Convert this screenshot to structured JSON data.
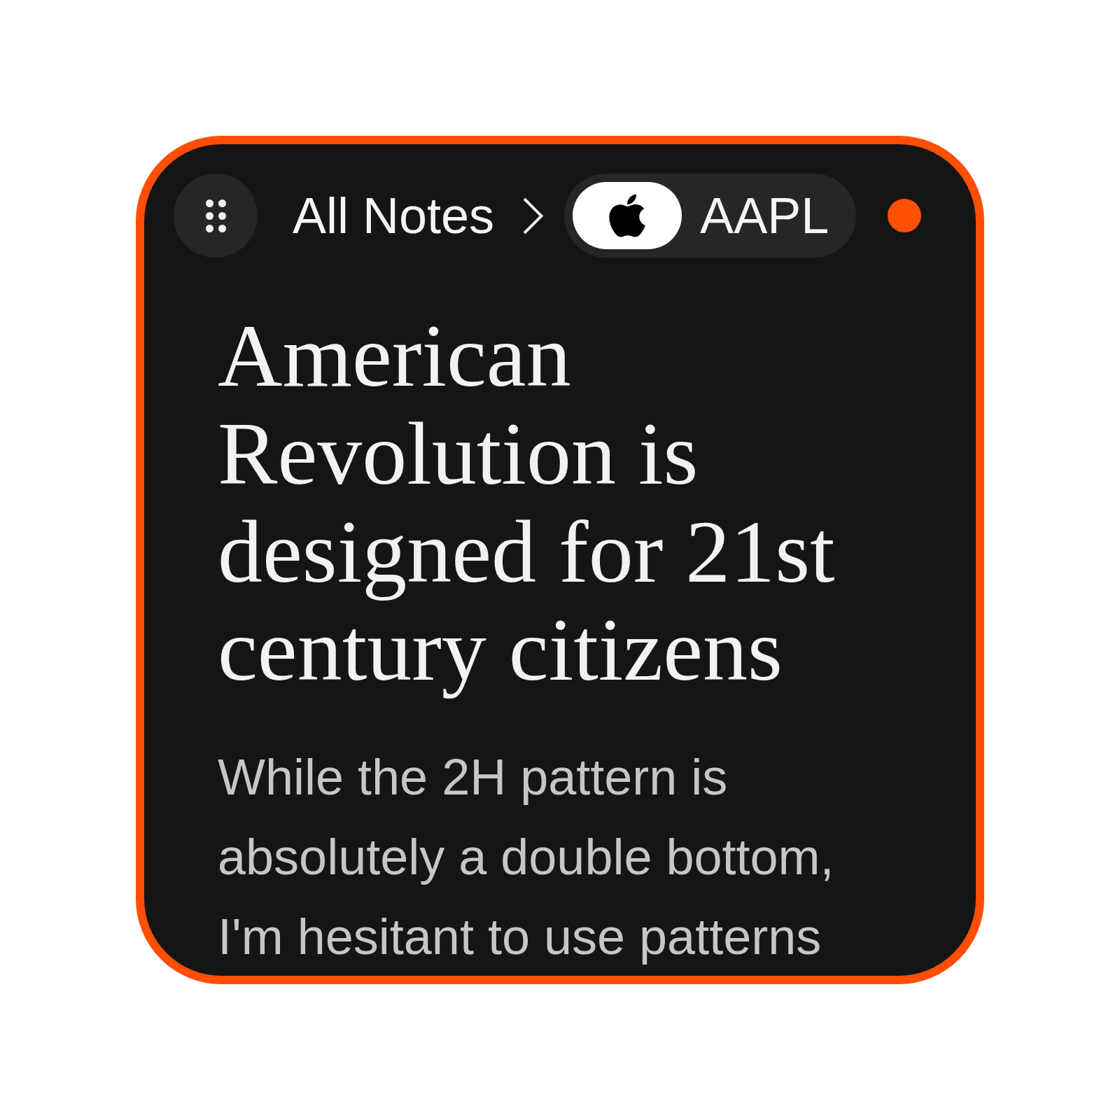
{
  "breadcrumb": {
    "link": "All Notes",
    "ticker": "AAPL"
  },
  "note": {
    "title": "American Revolution is designed for 21st century citizens",
    "body": "While the 2H pattern is absolutely a double bottom, I'm hesitant to use patterns"
  }
}
